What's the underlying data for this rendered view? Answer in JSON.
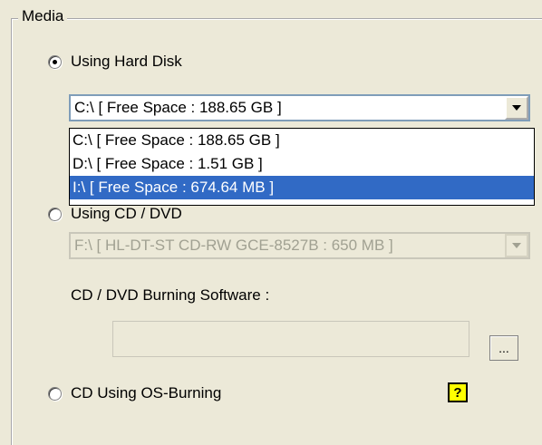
{
  "group": {
    "title": "Media"
  },
  "hard_disk": {
    "label": "Using Hard Disk",
    "selected_value": "C:\\ [ Free Space : 188.65 GB ]",
    "options": [
      "C:\\ [ Free Space : 188.65 GB ]",
      "D:\\ [ Free Space : 1.51 GB ]",
      "I:\\ [ Free Space : 674.64 MB ]"
    ],
    "highlighted_option": "I:\\ [ Free Space : 674.64 MB ]"
  },
  "cd_dvd": {
    "label": "Using CD / DVD",
    "selected_value": "F:\\ [ HL-DT-ST CD-RW GCE-8527B  : 650 MB ]",
    "burning_software_label": "CD / DVD Burning Software :",
    "browse_label": "..."
  },
  "os_burning": {
    "label": "CD Using OS-Burning",
    "help_glyph": "?"
  },
  "icons": {
    "radio": "radio-icon",
    "dropdown": "chevron-down-icon",
    "help": "help-icon"
  },
  "colors": {
    "dialog_bg": "#ece9d8",
    "selection": "#316ac5",
    "help_bg": "#ffff00",
    "disabled_text": "#a1a192"
  }
}
